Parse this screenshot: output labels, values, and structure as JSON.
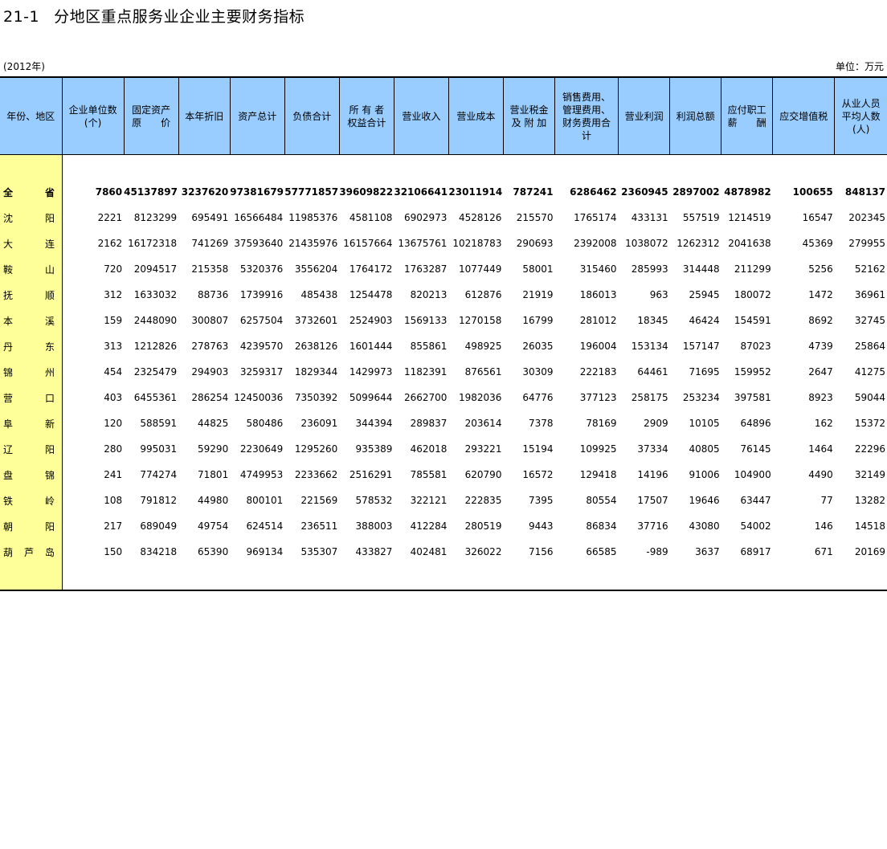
{
  "header": {
    "title_num": "21-1",
    "title_text": "分地区重点服务业企业主要财务指标",
    "year": "(2012年)",
    "unit": "单位：万元"
  },
  "columns": [
    [
      "年份、地区"
    ],
    [
      "企业单位数",
      "(个)"
    ],
    [
      "固定资产",
      "原　　价"
    ],
    [
      "本年折旧"
    ],
    [
      "资产总计"
    ],
    [
      "负债合计"
    ],
    [
      "所 有 者",
      "权益合计"
    ],
    [
      "营业收入"
    ],
    [
      "营业成本"
    ],
    [
      "营业税金",
      "及 附 加"
    ],
    [
      "销售费用、",
      "管理费用、",
      "财务费用合",
      "计"
    ],
    [
      "营业利润"
    ],
    [
      "利润总额"
    ],
    [
      "应付职工",
      "薪　　酬"
    ],
    [
      "应交增值税"
    ],
    [
      "从业人员",
      "平均人数",
      "(人)"
    ]
  ],
  "rows": [
    {
      "region": [
        "全",
        "省"
      ],
      "values": [
        "7860",
        "45137897",
        "3237620",
        "97381679",
        "57771857",
        "39609822",
        "32106641",
        "23011914",
        "787241",
        "6286462",
        "2360945",
        "2897002",
        "4878982",
        "100655",
        "848137"
      ]
    },
    {
      "region": [
        "沈",
        "阳"
      ],
      "values": [
        "2221",
        "8123299",
        "695491",
        "16566484",
        "11985376",
        "4581108",
        "6902973",
        "4528126",
        "215570",
        "1765174",
        "433131",
        "557519",
        "1214519",
        "16547",
        "202345"
      ]
    },
    {
      "region": [
        "大",
        "连"
      ],
      "values": [
        "2162",
        "16172318",
        "741269",
        "37593640",
        "21435976",
        "16157664",
        "13675761",
        "10218783",
        "290693",
        "2392008",
        "1038072",
        "1262312",
        "2041638",
        "45369",
        "279955"
      ]
    },
    {
      "region": [
        "鞍",
        "山"
      ],
      "values": [
        "720",
        "2094517",
        "215358",
        "5320376",
        "3556204",
        "1764172",
        "1763287",
        "1077449",
        "58001",
        "315460",
        "285993",
        "314448",
        "211299",
        "5256",
        "52162"
      ]
    },
    {
      "region": [
        "抚",
        "顺"
      ],
      "values": [
        "312",
        "1633032",
        "88736",
        "1739916",
        "485438",
        "1254478",
        "820213",
        "612876",
        "21919",
        "186013",
        "963",
        "25945",
        "180072",
        "1472",
        "36961"
      ]
    },
    {
      "region": [
        "本",
        "溪"
      ],
      "values": [
        "159",
        "2448090",
        "300807",
        "6257504",
        "3732601",
        "2524903",
        "1569133",
        "1270158",
        "16799",
        "281012",
        "18345",
        "46424",
        "154591",
        "8692",
        "32745"
      ]
    },
    {
      "region": [
        "丹",
        "东"
      ],
      "values": [
        "313",
        "1212826",
        "278763",
        "4239570",
        "2638126",
        "1601444",
        "855861",
        "498925",
        "26035",
        "196004",
        "153134",
        "157147",
        "87023",
        "4739",
        "25864"
      ]
    },
    {
      "region": [
        "锦",
        "州"
      ],
      "values": [
        "454",
        "2325479",
        "294903",
        "3259317",
        "1829344",
        "1429973",
        "1182391",
        "876561",
        "30309",
        "222183",
        "64461",
        "71695",
        "159952",
        "2647",
        "41275"
      ]
    },
    {
      "region": [
        "营",
        "口"
      ],
      "values": [
        "403",
        "6455361",
        "286254",
        "12450036",
        "7350392",
        "5099644",
        "2662700",
        "1982036",
        "64776",
        "377123",
        "258175",
        "253234",
        "397581",
        "8923",
        "59044"
      ]
    },
    {
      "region": [
        "阜",
        "新"
      ],
      "values": [
        "120",
        "588591",
        "44825",
        "580486",
        "236091",
        "344394",
        "289837",
        "203614",
        "7378",
        "78169",
        "2909",
        "10105",
        "64896",
        "162",
        "15372"
      ]
    },
    {
      "region": [
        "辽",
        "阳"
      ],
      "values": [
        "280",
        "995031",
        "59290",
        "2230649",
        "1295260",
        "935389",
        "462018",
        "293221",
        "15194",
        "109925",
        "37334",
        "40805",
        "76145",
        "1464",
        "22296"
      ]
    },
    {
      "region": [
        "盘",
        "锦"
      ],
      "values": [
        "241",
        "774274",
        "71801",
        "4749953",
        "2233662",
        "2516291",
        "785581",
        "620790",
        "16572",
        "129418",
        "14196",
        "91006",
        "104900",
        "4490",
        "32149"
      ]
    },
    {
      "region": [
        "铁",
        "岭"
      ],
      "values": [
        "108",
        "791812",
        "44980",
        "800101",
        "221569",
        "578532",
        "322121",
        "222835",
        "7395",
        "80554",
        "17507",
        "19646",
        "63447",
        "77",
        "13282"
      ]
    },
    {
      "region": [
        "朝",
        "阳"
      ],
      "values": [
        "217",
        "689049",
        "49754",
        "624514",
        "236511",
        "388003",
        "412284",
        "280519",
        "9443",
        "86834",
        "37716",
        "43080",
        "54002",
        "146",
        "14518"
      ]
    },
    {
      "region": [
        "葫",
        "芦",
        "岛"
      ],
      "values": [
        "150",
        "834218",
        "65390",
        "969134",
        "535307",
        "433827",
        "402481",
        "326022",
        "7156",
        "66585",
        "-989",
        "3637",
        "68917",
        "671",
        "20169"
      ]
    }
  ]
}
